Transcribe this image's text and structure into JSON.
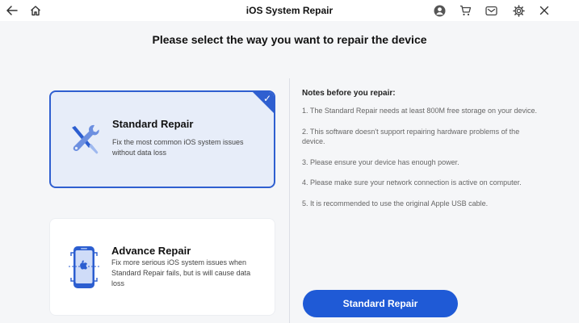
{
  "window": {
    "title": "iOS System Repair",
    "back_icon": "arrow-left",
    "home_icon": "home",
    "account_icon": "user-circle",
    "cart_icon": "cart",
    "mail_icon": "mail",
    "settings_icon": "gear",
    "close_icon": "close"
  },
  "page": {
    "heading": "Please select the way you want to repair the device"
  },
  "options": [
    {
      "title": "Standard Repair",
      "description": "Fix the most common iOS system issues without data loss",
      "selected": true,
      "icon": "wrench-screwdriver"
    },
    {
      "title": "Advance Repair",
      "description": "Fix more serious iOS system issues when Standard Repair fails, but is will cause data loss",
      "selected": false,
      "icon": "iphone-scan"
    }
  ],
  "notes": {
    "title": "Notes before you repair:",
    "items": [
      "1. The Standard Repair needs at least 800M free storage on your device.",
      "2. This software doesn't support repairing hardware problems of the device.",
      "3. Please ensure your device has enough power.",
      "4. Please make sure your network connection is active on computer.",
      "5. It is recommended to use the original Apple USB cable."
    ]
  },
  "action": {
    "button_label": "Standard Repair"
  },
  "colors": {
    "accent": "#1f5ad6",
    "selected_card_bg": "#e7edf9"
  }
}
